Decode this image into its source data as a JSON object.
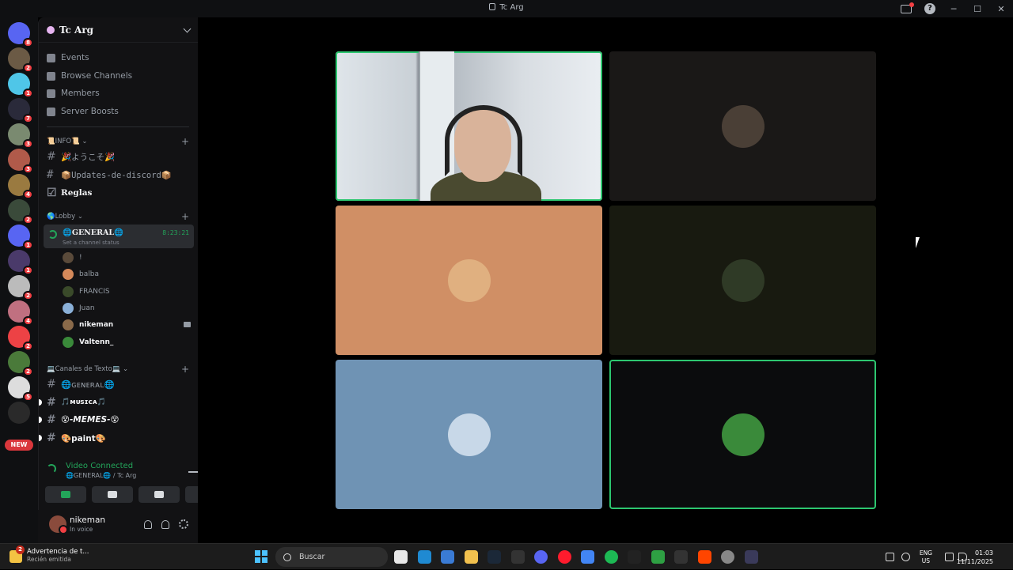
{
  "window": {
    "title": "Tc Arg"
  },
  "guilds": {
    "new_label": "NEW",
    "items": [
      {
        "badge": "8",
        "color": "#5865f2"
      },
      {
        "badge": "2",
        "color": "#6b5a45"
      },
      {
        "badge": "1",
        "color": "#4fc6e8"
      },
      {
        "badge": "7",
        "color": "#2a2a3a"
      },
      {
        "badge": "3",
        "color": "#7a8a70"
      },
      {
        "badge": "3",
        "color": "#b05a4a"
      },
      {
        "badge": "4",
        "color": "#9a7a40"
      },
      {
        "badge": "2",
        "color": "#3a4a3a"
      },
      {
        "badge": "1",
        "color": "#5865f2"
      },
      {
        "badge": "1",
        "color": "#4a3a6a"
      },
      {
        "badge": "2",
        "color": "#bbbbbb"
      },
      {
        "badge": "4",
        "color": "#c07080"
      },
      {
        "badge": "2",
        "color": "#ed4245"
      },
      {
        "badge": "2",
        "color": "#4a7a3a"
      },
      {
        "badge": "5",
        "color": "#dddddd"
      },
      {
        "badge": "",
        "color": "#2a2a2a"
      }
    ]
  },
  "server": {
    "name": "Tc Arg",
    "menu": [
      "Events",
      "Browse Channels",
      "Members",
      "Server Boosts"
    ],
    "categories": {
      "info": "📜INFO📜",
      "lobby": "🌎Lobby",
      "text": "💻Canales de Texto💻"
    },
    "info_channels": [
      "🎉ようこそ🎉",
      "📦Updates-de-discord📦",
      "Reglas"
    ],
    "voice_channel": {
      "name": "🌐GENERAL🌐",
      "status": "Set a channel status",
      "timer": "8:23:21"
    },
    "voice_users": [
      {
        "name": "!",
        "color": "#5a4a3a",
        "active": false
      },
      {
        "name": "balba",
        "color": "#d4895a",
        "active": false
      },
      {
        "name": "FRANCIS",
        "color": "#3a4a2a",
        "active": false
      },
      {
        "name": "Juan",
        "color": "#8ab0d8",
        "active": false
      },
      {
        "name": "nikeman",
        "color": "#8a6a4a",
        "active": true
      },
      {
        "name": "Valtenn_",
        "color": "#3a8a3a",
        "active": true
      }
    ],
    "text_channels": [
      "🌐ɢᴇɴᴇʀᴀʟ🌐",
      "🎵ᴍᴜsɪᴄᴀ🎵",
      "😵-𝙈𝙀𝙈𝙀𝙎-😵",
      "🎨paint🎨"
    ]
  },
  "rtc": {
    "status": "Video Connected",
    "location": "🌐GENERAL🌐 / Tc Arg"
  },
  "user": {
    "name": "nikeman",
    "status": "In voice"
  },
  "tiles": [
    {
      "bg": "#c8cfd6",
      "avatar": "#7a6a4a",
      "speaking": true,
      "webcam": true
    },
    {
      "bg": "#1a1817",
      "avatar": "#4a3f36",
      "speaking": false,
      "webcam": false
    },
    {
      "bg": "#d08f65",
      "avatar": "#e0b080",
      "speaking": false,
      "webcam": false
    },
    {
      "bg": "#181a10",
      "avatar": "#2f3a26",
      "speaking": false,
      "webcam": false
    },
    {
      "bg": "#6f93b4",
      "avatar": "#c8d8e8",
      "speaking": false,
      "webcam": false
    },
    {
      "bg": "#0b0c0d",
      "avatar": "#3a8a3a",
      "speaking": true,
      "webcam": false
    }
  ],
  "taskbar": {
    "notification_title": "Advertencia de t...",
    "notification_sub": "Recién emitida",
    "notification_badge": "2",
    "search_placeholder": "Buscar",
    "lang1": "ENG",
    "lang2": "US",
    "time": "01:03",
    "date": "11/11/2025",
    "apps": [
      "#e8e8e8",
      "#1f8ad2",
      "#3a7bd5",
      "#f2c14e",
      "#1b2838",
      "#333333",
      "#5865f2",
      "#ff1b2d",
      "#4285f4",
      "#1db954",
      "#222222",
      "#2ea043",
      "#333333",
      "#ff4500",
      "#888888",
      "#3a3a5a"
    ]
  }
}
